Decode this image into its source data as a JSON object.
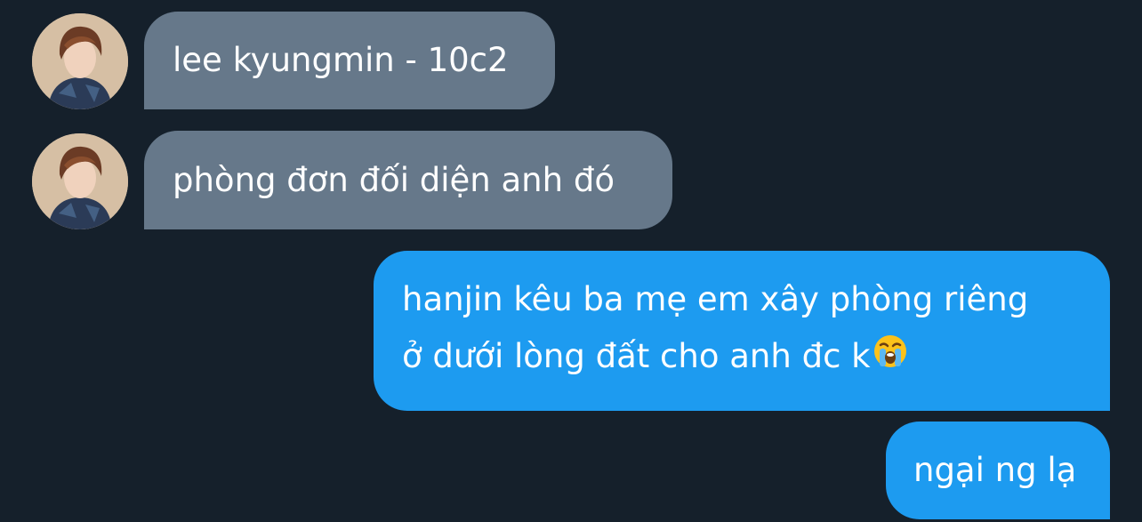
{
  "messages": [
    {
      "direction": "incoming",
      "text": "lee kyungmin - 10c2"
    },
    {
      "direction": "incoming",
      "text": "phòng đơn đối diện anh đó"
    },
    {
      "direction": "outgoing",
      "lines": [
        "hanjin kêu ba mẹ em xây phòng riêng",
        "ở dưới lòng đất cho anh đc k"
      ],
      "emoji": "loudly-crying-face"
    },
    {
      "direction": "outgoing",
      "text": "ngại ng lạ"
    }
  ],
  "colors": {
    "background": "#15202b",
    "incoming_bubble": "#66788a",
    "outgoing_bubble": "#1d9bf0",
    "text": "#ffffff"
  }
}
